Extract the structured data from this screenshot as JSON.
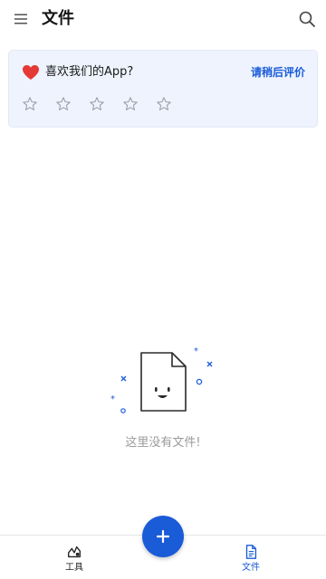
{
  "header": {
    "title": "文件",
    "menu_icon": "menu-icon",
    "search_icon": "search-icon"
  },
  "rating_card": {
    "question": "喜欢我们的App?",
    "action_label": "请稍后评价",
    "stars_total": 5,
    "stars_selected": 0,
    "heart_color": "#e53935"
  },
  "empty_state": {
    "message": "这里没有文件!",
    "illustration_icon": "empty-document-icon"
  },
  "bottom_nav": {
    "items": [
      {
        "label": "工具",
        "icon": "tools-icon",
        "active": false
      },
      {
        "label": "文件",
        "icon": "document-icon",
        "active": true
      }
    ]
  },
  "fab": {
    "icon": "plus-icon"
  },
  "colors": {
    "accent": "#1a5bd8",
    "card_background": "#eef3fd",
    "muted_text": "#9a9a9a"
  }
}
